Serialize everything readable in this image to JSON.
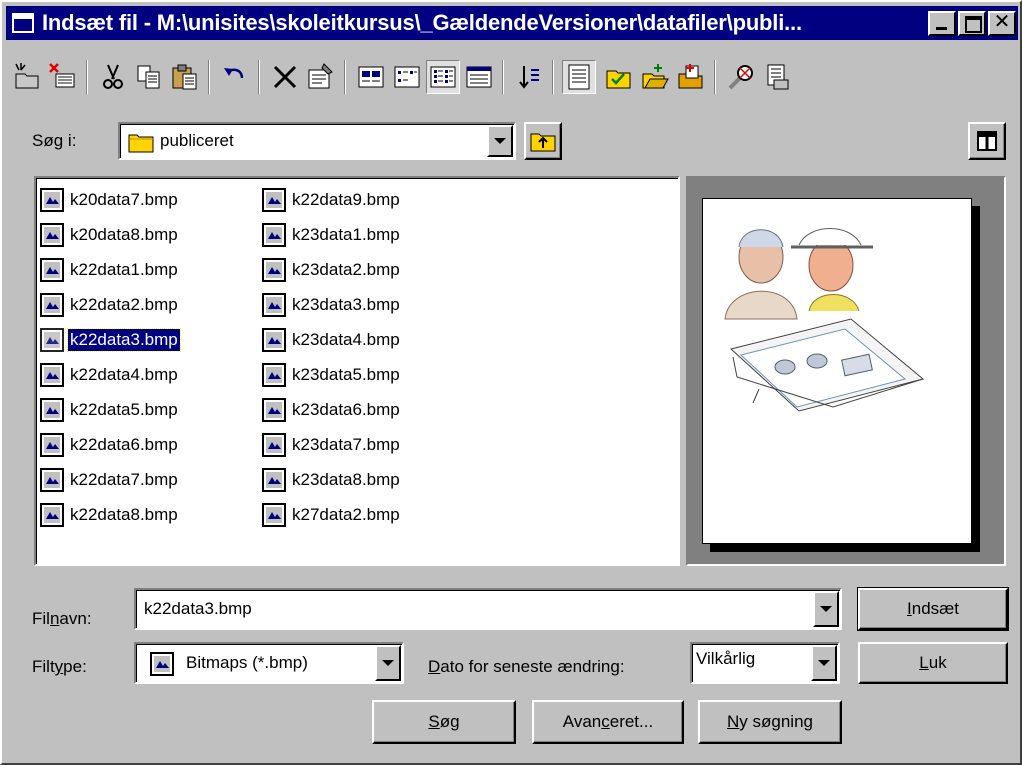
{
  "window": {
    "title": "Indsæt fil - M:\\unisites\\skoleitkursus\\_GældendeVersioner\\datafiler\\publi..."
  },
  "toolbar": {
    "items": [
      "new-folder-icon",
      "delete-red-icon",
      "cut-icon",
      "copy-icon",
      "paste-icon",
      "undo-icon",
      "delete-icon",
      "properties-icon",
      "large-icons-icon",
      "small-icons-icon",
      "list-view-icon",
      "details-view-icon",
      "arrange-icon",
      "preview-icon",
      "favorites-icon",
      "open-folder-icon",
      "add-favorite-icon",
      "find-icon",
      "map-drive-icon"
    ]
  },
  "lookin": {
    "label_pre": "Sø",
    "label_key": "g",
    "label_post": " i:",
    "value": "publiceret"
  },
  "files": {
    "column1": [
      "k20data7.bmp",
      "k20data8.bmp",
      "k22data1.bmp",
      "k22data2.bmp",
      "k22data3.bmp",
      "k22data4.bmp",
      "k22data5.bmp",
      "k22data6.bmp",
      "k22data7.bmp",
      "k22data8.bmp"
    ],
    "column2": [
      "k22data9.bmp",
      "k23data1.bmp",
      "k23data2.bmp",
      "k23data3.bmp",
      "k23data4.bmp",
      "k23data5.bmp",
      "k23data6.bmp",
      "k23data7.bmp",
      "k23data8.bmp",
      "k27data2.bmp"
    ],
    "selected": "k22data3.bmp"
  },
  "filename": {
    "label_pre": "Fil",
    "label_key": "n",
    "label_post": "avn:",
    "value": "k22data3.bmp"
  },
  "filetype": {
    "label_pre": "Filt",
    "label_key": "y",
    "label_post": "pe:",
    "value": "Bitmaps (*.bmp)"
  },
  "date": {
    "label_key": "D",
    "label_post": "ato for seneste ændring:",
    "value": "Vilkårlig"
  },
  "buttons": {
    "insert_key": "I",
    "insert_post": "ndsæt",
    "close_key": "L",
    "close_post": "uk",
    "search_pre": "",
    "search_key": "S",
    "search_post": "øg",
    "advanced_pre": "Avan",
    "advanced_key": "c",
    "advanced_post": "eret...",
    "newsearch_key": "N",
    "newsearch_post": "y søgning"
  },
  "colors": {
    "titlebar": "#000080",
    "face": "#c0c0c0",
    "selection": "#000080"
  }
}
